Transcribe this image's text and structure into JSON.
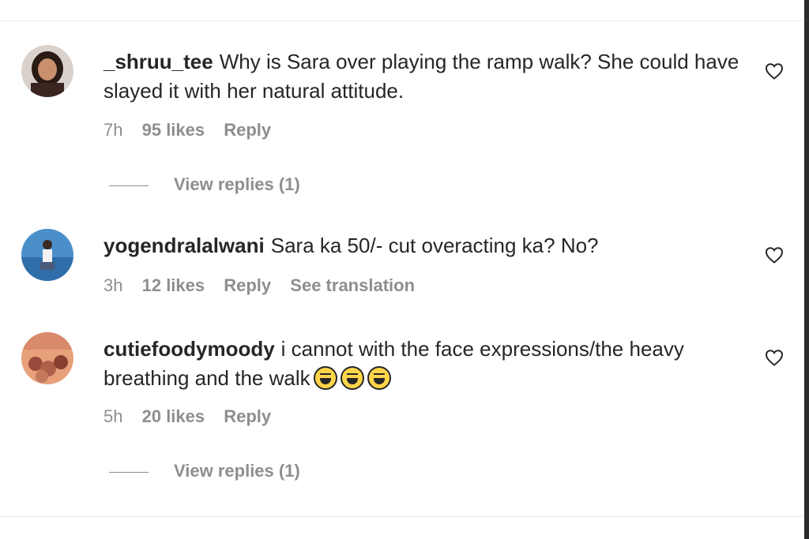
{
  "comments": [
    {
      "username": "_shruu_tee",
      "text": "Why is Sara over playing the ramp walk? She could have slayed it with her natural attitude.",
      "time": "7h",
      "likes": "95 likes",
      "reply": "Reply",
      "view_replies": "View replies (1)"
    },
    {
      "username": "yogendralalwani",
      "text": "Sara ka 50/- cut overacting ka? No?",
      "time": "3h",
      "likes": "12 likes",
      "reply": "Reply",
      "see_translation": "See translation"
    },
    {
      "username": "cutiefoodymoody",
      "text": "i cannot with the face expressions/the heavy breathing and the walk",
      "emoji": "tears-of-joy-emoji",
      "time": "5h",
      "likes": "20 likes",
      "reply": "Reply",
      "view_replies": "View replies (1)"
    }
  ],
  "icons": {
    "like": "heart-outline-icon"
  },
  "colors": {
    "text": "#262626",
    "secondary": "#8e8e8e",
    "divider": "#ececec"
  }
}
